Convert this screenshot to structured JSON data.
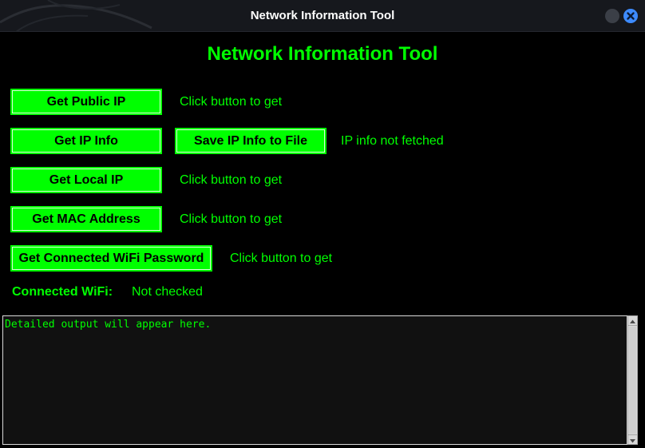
{
  "window": {
    "title": "Network Information Tool"
  },
  "heading": "Network Information Tool",
  "rows": {
    "public_ip": {
      "button": "Get Public IP",
      "status": "Click button to get"
    },
    "ip_info": {
      "button": "Get IP Info",
      "save_button": "Save IP Info to File",
      "status": "IP info not fetched"
    },
    "local_ip": {
      "button": "Get Local IP",
      "status": "Click button to get"
    },
    "mac": {
      "button": "Get MAC Address",
      "status": "Click button to get"
    },
    "wifi_password": {
      "button": "Get Connected WiFi Password",
      "status": "Click button to get"
    }
  },
  "connected_wifi": {
    "label": "Connected WiFi:",
    "value": "Not checked"
  },
  "output": {
    "text": "Detailed output will appear here."
  },
  "colors": {
    "accent": "#00ff00",
    "background": "#000000",
    "titlebar": "#16181d",
    "close_button": "#3d8bff"
  },
  "icons": {
    "minimize": "circle-icon",
    "close": "close-icon"
  }
}
